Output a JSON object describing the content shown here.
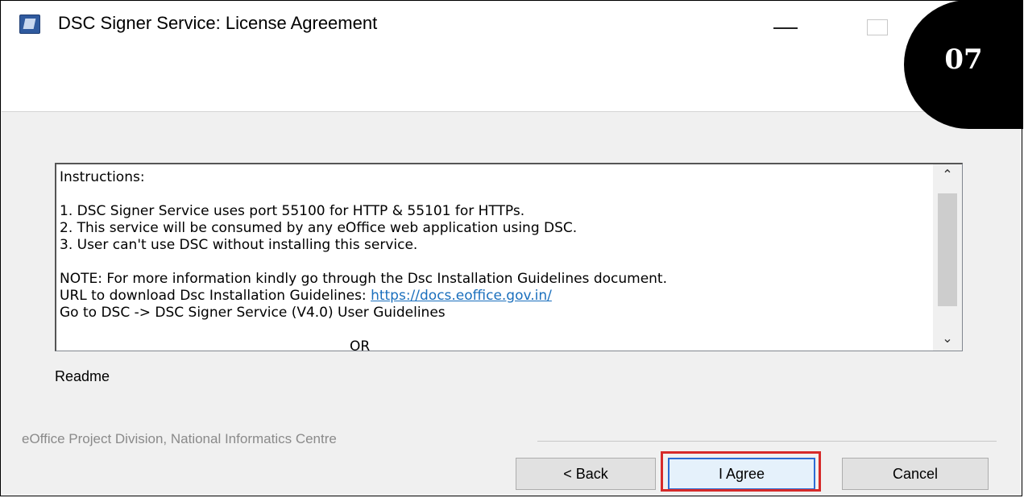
{
  "window": {
    "title": "DSC Signer Service: License Agreement",
    "app_icon": "installer-icon"
  },
  "badge": {
    "step": "07"
  },
  "license_text": {
    "lines": {
      "heading": "Instructions:",
      "l1": "1. DSC Signer Service uses port 55100 for HTTP & 55101 for HTTPs.",
      "l2": "2. This service will be consumed by any eOffice web application using DSC.",
      "l3": "3. User can't use DSC without installing this service.",
      "note": "NOTE: For more information kindly go through the Dsc Installation Guidelines document.",
      "url_prefix": "URL to download Dsc Installation Guidelines: ",
      "url": "https://docs.eoffice.gov.in/",
      "goto": "Go to DSC -> DSC Signer Service (V4.0) User Guidelines",
      "or": "OR"
    }
  },
  "readme_label": "Readme",
  "footer": {
    "branding": "eOffice Project Division, National Informatics Centre"
  },
  "buttons": {
    "back": "< Back",
    "agree": "I Agree",
    "cancel": "Cancel"
  },
  "colors": {
    "highlight": "#d62a2a",
    "link": "#1a6fbd",
    "badge": "#000000"
  }
}
